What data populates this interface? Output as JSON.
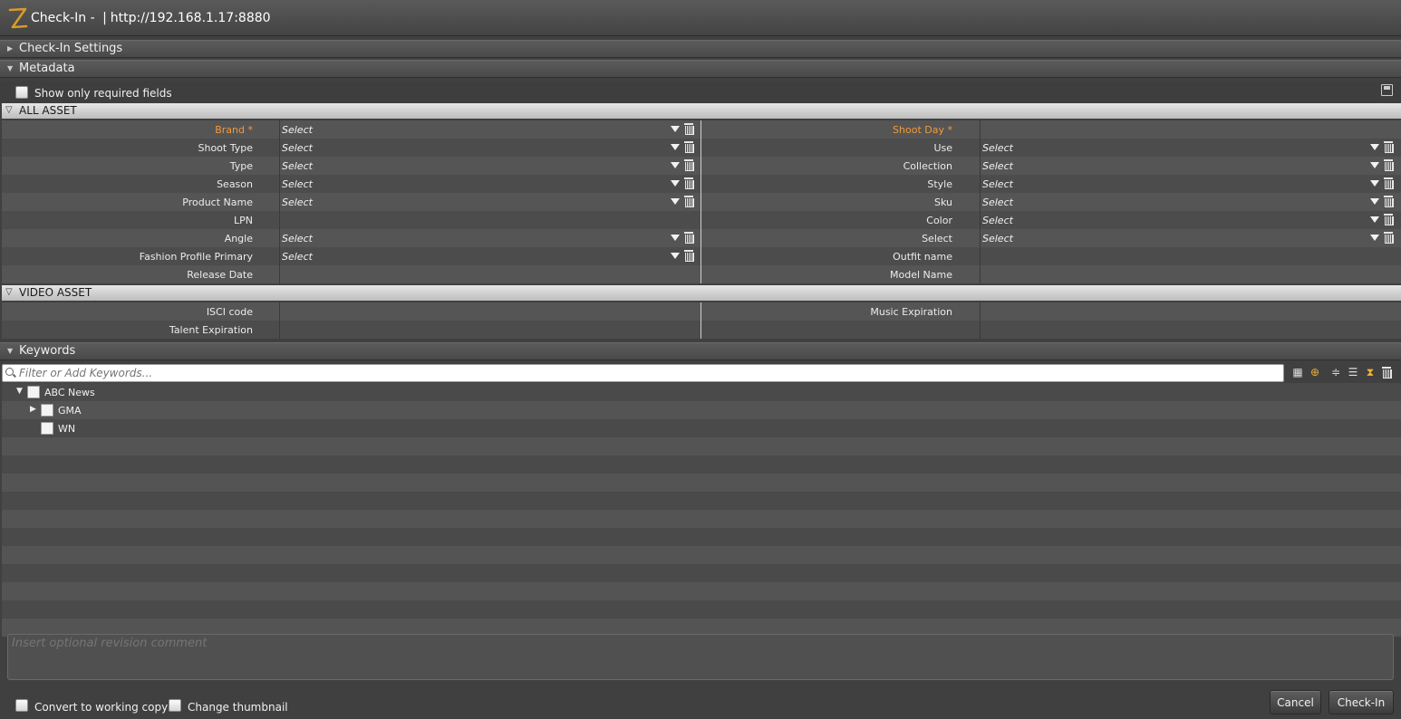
{
  "window": {
    "title": "Check-In -",
    "url_separator": "|",
    "url": "http://192.168.1.17:8880"
  },
  "colors": {
    "required_label": "#f29a3a",
    "logo": "#d99a2b",
    "background": "#404040"
  },
  "sections": {
    "checkin_settings": {
      "label": "Check-In Settings",
      "expanded": false
    },
    "metadata": {
      "label": "Metadata",
      "expanded": true
    },
    "keywords": {
      "label": "Keywords",
      "expanded": true
    }
  },
  "metadata": {
    "show_only_required_label": "Show only required fields",
    "show_only_required_checked": false,
    "save_icon": "save-icon",
    "groups": {
      "all_asset": {
        "label": "ALL ASSET",
        "left": [
          {
            "label": "Brand *",
            "required": true,
            "value": "Select",
            "dropdown": true
          },
          {
            "label": "Shoot Type",
            "value": "Select",
            "dropdown": true
          },
          {
            "label": "Type",
            "value": "Select",
            "dropdown": true
          },
          {
            "label": "Season",
            "value": "Select",
            "dropdown": true
          },
          {
            "label": "Product Name",
            "value": "Select",
            "dropdown": true
          },
          {
            "label": "LPN",
            "value": "",
            "dropdown": false
          },
          {
            "label": "Angle",
            "value": "Select",
            "dropdown": true
          },
          {
            "label": "Fashion Profile Primary",
            "value": "Select",
            "dropdown": true
          },
          {
            "label": "Release Date",
            "value": "",
            "dropdown": false
          }
        ],
        "right": [
          {
            "label": "Shoot Day *",
            "required": true,
            "value": "",
            "dropdown": false
          },
          {
            "label": "Use",
            "value": "Select",
            "dropdown": true
          },
          {
            "label": "Collection",
            "value": "Select",
            "dropdown": true
          },
          {
            "label": "Style",
            "value": "Select",
            "dropdown": true
          },
          {
            "label": "Sku",
            "value": "Select",
            "dropdown": true
          },
          {
            "label": "Color",
            "value": "Select",
            "dropdown": true
          },
          {
            "label": "Select",
            "value": "Select",
            "dropdown": true
          },
          {
            "label": "Outfit name",
            "value": "",
            "dropdown": false
          },
          {
            "label": "Model Name",
            "value": "",
            "dropdown": false
          }
        ]
      },
      "video_asset": {
        "label": "VIDEO ASSET",
        "left": [
          {
            "label": "ISCI code",
            "value": "",
            "dropdown": false
          },
          {
            "label": "Talent Expiration",
            "value": "",
            "dropdown": false
          }
        ],
        "right": [
          {
            "label": "Music Expiration",
            "value": "",
            "dropdown": false
          },
          {
            "label": "",
            "value": "",
            "dropdown": false
          }
        ]
      }
    }
  },
  "keywords": {
    "filter_placeholder": "Filter or Add Keywords...",
    "toolbar_icons": [
      "select-all-icon",
      "search-add-icon",
      "collapse-icon",
      "list-filter-icon",
      "hourglass-icon",
      "trash-icon"
    ],
    "tree": [
      {
        "label": "ABC News",
        "depth": 0,
        "expanded": true,
        "has_children": true,
        "checked": false
      },
      {
        "label": "GMA",
        "depth": 1,
        "expanded": false,
        "has_children": true,
        "checked": false
      },
      {
        "label": "WN",
        "depth": 1,
        "expanded": false,
        "has_children": false,
        "checked": false
      }
    ]
  },
  "footer": {
    "comment_placeholder": "Insert optional revision comment",
    "convert_label": "Convert to working copy",
    "convert_checked": false,
    "thumbnail_label": "Change thumbnail",
    "thumbnail_checked": false,
    "cancel_label": "Cancel",
    "checkin_label": "Check-In"
  }
}
